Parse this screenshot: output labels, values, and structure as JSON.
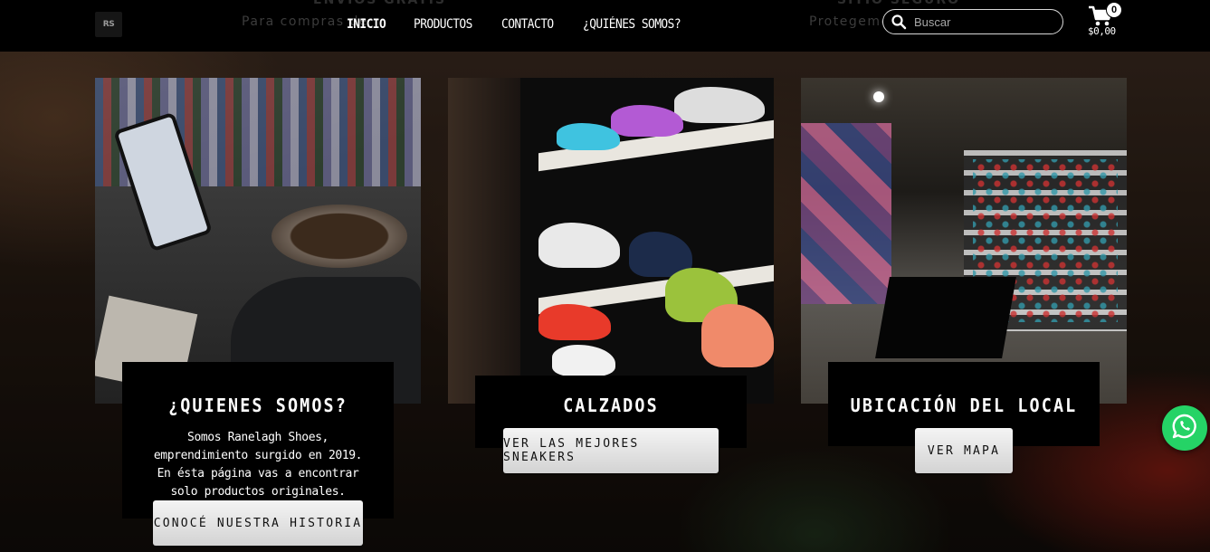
{
  "header": {
    "logo_text": "RS",
    "ghost_left_title": "ENVIOS GRATIS",
    "ghost_left_text": "Para compras de",
    "ghost_right_title": "SITIO SEGURO",
    "ghost_right_text": "Protegemos",
    "nav": [
      "INICIO",
      "PRODUCTOS",
      "CONTACTO",
      "¿QUIÉNES SOMOS?"
    ],
    "search_placeholder": "Buscar",
    "cart_count": "0",
    "cart_total": "$0,00"
  },
  "cards": [
    {
      "title": "¿QUIENES SOMOS?",
      "description": "Somos Ranelagh Shoes, emprendimiento surgido en 2019. En ésta página vas a encontrar solo productos originales.",
      "button": "CONOCÉ NUESTRA HISTORIA"
    },
    {
      "title": "CALZADOS",
      "button": "VER LAS MEJORES SNEAKERS"
    },
    {
      "title": "UBICACIÓN DEL LOCAL",
      "button": "VER MAPA"
    }
  ],
  "colors": {
    "whatsapp": "#25d366",
    "header_bg": "#000000",
    "button_bg": "#e6e6e6"
  },
  "icons": [
    "search-icon",
    "cart-icon",
    "whatsapp-icon"
  ]
}
